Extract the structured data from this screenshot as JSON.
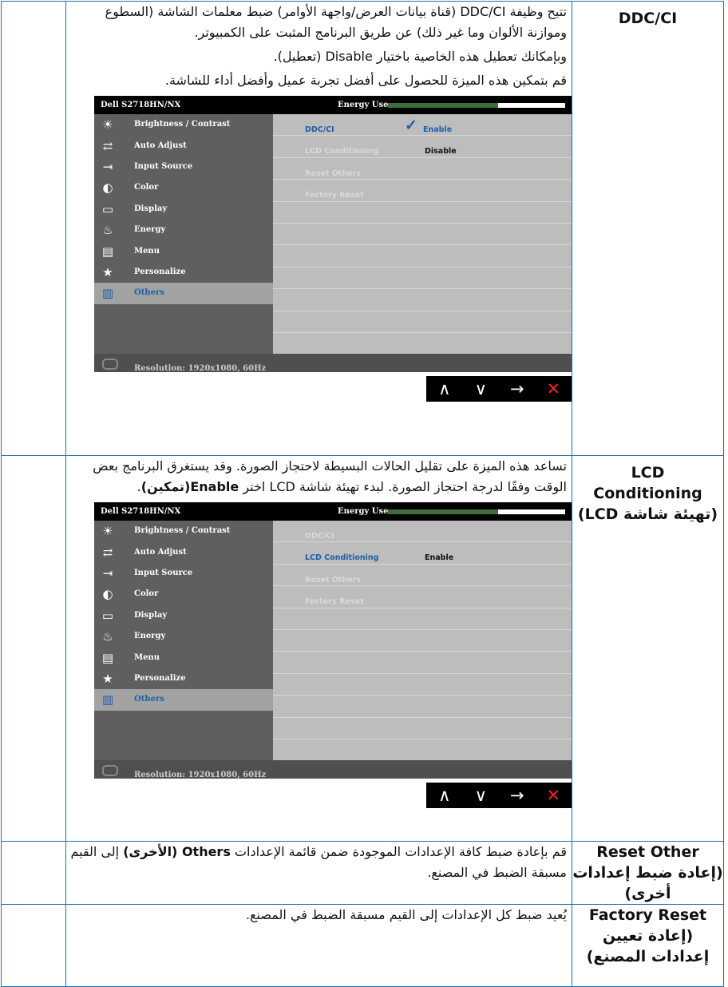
{
  "rows": [
    {
      "feature": "DDC/CI",
      "paragraphs": [
        "تتيح وظيفة DDC/CI (قناة بيانات العرض/واجهة الأوامر) ضبط معلمات الشاشة (السطوع وموازنة الألوان وما غير ذلك) عن طريق البرنامج المثبت على الكمبيوتر.",
        "وبإمكانك تعطيل هذه الخاصية باختيار Disable (تعطيل).",
        "قم بتمكين هذه الميزة للحصول على أفضل تجربة عميل وأفضل أداء للشاشة."
      ]
    },
    {
      "feature_line1": "LCD",
      "feature_line2": "Conditioning",
      "feature_line3": "(تهيئة شاشة LCD)",
      "para_plain": "تساعد هذه الميزة على تقليل الحالات البسيطة لاحتجاز الصورة. وقد يستغرق البرنامج بعض الوقت وفقًا لدرجة احتجاز الصورة. لبدء تهيئة شاشة LCD اختر ",
      "para_bold": "Enable(تمكين)",
      "para_end": "."
    },
    {
      "feature": "Reset Other (إعادة ضبط إعدادات أخرى)",
      "para_plain": "قم بإعادة ضبط كافة الإعدادات الموجودة ضمن قائمة الإعدادات ",
      "para_bold": "Others (الأخرى)",
      "para_end": " إلى القيم مسبقة الضبط في المصنع."
    },
    {
      "feature": "Factory Reset (إعادة تعيين إعدادات المصنع)",
      "para": "يُعيد ضبط كل الإعدادات إلى القيم مسبقة الضبط في المصنع."
    }
  ],
  "osd": {
    "model": "Dell S2718HN/NX",
    "energy_label": "Energy Use",
    "energy_level": 0.62,
    "energy_color": "#3d6e3a",
    "menu": [
      {
        "label": "Brightness / Contrast",
        "icon": "brightness-icon"
      },
      {
        "label": "Auto Adjust",
        "icon": "auto-adjust-icon"
      },
      {
        "label": "Input Source",
        "icon": "input-source-icon"
      },
      {
        "label": "Color",
        "icon": "color-icon"
      },
      {
        "label": "Display",
        "icon": "display-icon"
      },
      {
        "label": "Energy",
        "icon": "energy-icon"
      },
      {
        "label": "Menu",
        "icon": "menu-icon"
      },
      {
        "label": "Personalize",
        "icon": "star-icon"
      },
      {
        "label": "Others",
        "icon": "others-icon"
      }
    ],
    "submenu": [
      "DDC/CI",
      "LCD Conditioning",
      "Reset Others",
      "Factory Reset"
    ],
    "screen1": {
      "ddcci_value": "Enable",
      "lcd_value": "Disable"
    },
    "screen2": {
      "lcd_value": "Enable"
    },
    "resolution": "Resolution: 1920x1080, 60Hz",
    "controls": [
      "up-icon",
      "down-icon",
      "right-arrow-icon",
      "close-icon"
    ]
  }
}
